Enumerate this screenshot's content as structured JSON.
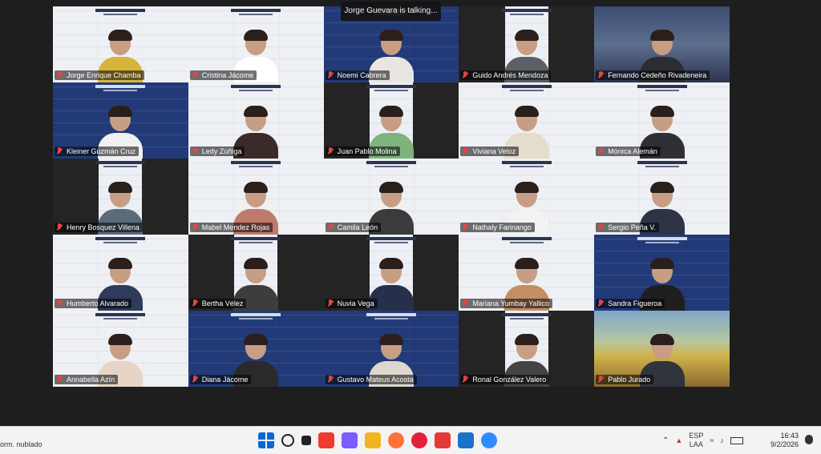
{
  "meeting": {
    "talking_banner": "Jorge Guevara is talking..."
  },
  "participants": [
    {
      "name": "Jorge Enrique Chamba",
      "muted": true,
      "background": "white",
      "shirt": "#d8b43a"
    },
    {
      "name": "Cristina Jácome",
      "muted": true,
      "background": "white",
      "shirt": "#ffffff"
    },
    {
      "name": "Noemi Cabrera",
      "muted": true,
      "background": "blue",
      "shirt": "#e9e6e2"
    },
    {
      "name": "Guido Andrés Mendoza",
      "muted": true,
      "background": "dark",
      "shirt": "#5c5f66"
    },
    {
      "name": "Fernando Cedeño Rivadeneira",
      "muted": true,
      "background": "room",
      "shirt": "#2b2d33"
    },
    {
      "name": "Kleiner Guzmán Cruz",
      "muted": true,
      "background": "blue",
      "shirt": "#f0f0f0"
    },
    {
      "name": "Ledy Zúñiga",
      "muted": true,
      "background": "white",
      "shirt": "#3a2b28"
    },
    {
      "name": "Juan Pablo Molina",
      "muted": true,
      "background": "dark",
      "shirt": "#7eb37c"
    },
    {
      "name": "Viviana Veloz",
      "muted": true,
      "background": "white",
      "shirt": "#e4dccd"
    },
    {
      "name": "Mónica Alemán",
      "muted": true,
      "background": "white",
      "shirt": "#2f2f36"
    },
    {
      "name": "Henry Bosquez Villena",
      "muted": true,
      "background": "dark",
      "shirt": "#5a6b7a"
    },
    {
      "name": "Mabel Mendez Rojas",
      "muted": true,
      "background": "white",
      "shirt": "#c07a6b"
    },
    {
      "name": "Camila León",
      "muted": true,
      "background": "white",
      "shirt": "#3b3b3b"
    },
    {
      "name": "Nathaly Farinango",
      "muted": true,
      "background": "white",
      "shirt": "#f2f2f2"
    },
    {
      "name": "Sergio Peña V.",
      "muted": true,
      "background": "white",
      "shirt": "#2c3446"
    },
    {
      "name": "Humberto Alvarado",
      "muted": true,
      "background": "white",
      "shirt": "#2e3b5a"
    },
    {
      "name": "Bertha Vélez",
      "muted": true,
      "background": "dark",
      "shirt": "#3d3d3d"
    },
    {
      "name": "Nuvia Vega",
      "muted": true,
      "background": "dark",
      "shirt": "#26304a"
    },
    {
      "name": "Mariana Yumbay Yallico",
      "muted": true,
      "background": "white",
      "shirt": "#c48e63"
    },
    {
      "name": "Sandra Figueroa",
      "muted": true,
      "background": "blue",
      "shirt": "#1f1f1f"
    },
    {
      "name": "Annabella Azín",
      "muted": true,
      "background": "white",
      "shirt": "#e6d5c5"
    },
    {
      "name": "Diana Jácome",
      "muted": true,
      "background": "blue",
      "shirt": "#2a2a2a"
    },
    {
      "name": "Gustavo Mateus Acosta",
      "muted": true,
      "background": "blue",
      "shirt": "#ddd7cf"
    },
    {
      "name": "Ronal González Valero",
      "muted": true,
      "background": "dark",
      "shirt": "#444"
    },
    {
      "name": "Pablo Jurado",
      "muted": true,
      "background": "art",
      "shirt": "#30343c"
    }
  ],
  "taskbar": {
    "weather_text": "orm. nublado",
    "apps": [
      {
        "icon": "windows-start-icon",
        "color": "#0a66d8"
      },
      {
        "icon": "search-icon",
        "color": "#222222"
      },
      {
        "icon": "task-view-icon",
        "color": "#222222"
      },
      {
        "icon": "anydesk-icon",
        "color": "#ef3b2d"
      },
      {
        "icon": "copilot-icon",
        "color": "#7a5cff"
      },
      {
        "icon": "file-explorer-icon",
        "color": "#f2b522"
      },
      {
        "icon": "firefox-icon",
        "color": "#ff7139"
      },
      {
        "icon": "opera-icon",
        "color": "#e2203a"
      },
      {
        "icon": "anydesk-red-icon",
        "color": "#e53935"
      },
      {
        "icon": "outlook-icon",
        "color": "#1a73c8"
      },
      {
        "icon": "zoom-icon",
        "color": "#2d8cff"
      }
    ],
    "tray": {
      "lang_top": "ESP",
      "lang_bottom": "LAA",
      "time": "16:43",
      "date": "9/2/2026"
    }
  }
}
